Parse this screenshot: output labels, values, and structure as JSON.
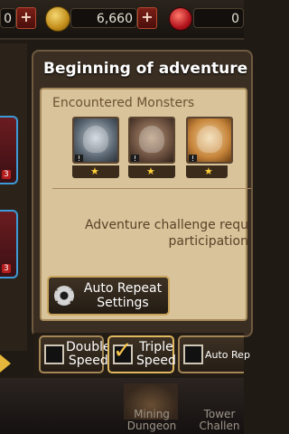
{
  "topbar": {
    "left_value": "0",
    "coins": "6,660",
    "gems": "0",
    "plus": "+"
  },
  "left_cards": [
    {
      "tag": "3"
    },
    {
      "tag": "3"
    }
  ],
  "dialog": {
    "title": "Beginning of adventure",
    "encountered_label": "Encountered Monsters",
    "monsters": [
      {
        "icon": "werewolf-icon",
        "badge": "!",
        "star": "★"
      },
      {
        "icon": "wolf-beast-icon",
        "badge": "!",
        "star": "★"
      },
      {
        "icon": "pirate-cat-icon",
        "badge": "!",
        "star": "★"
      }
    ],
    "challenge_line1": "Adventure challenge requ",
    "challenge_line2": "participation",
    "auto_repeat_line1": "Auto Repeat",
    "auto_repeat_line2": "Settings"
  },
  "speed": {
    "double_line1": "Double",
    "double_line2": "Speed",
    "double_checked": false,
    "triple_line1": "Triple",
    "triple_line2": "Speed",
    "triple_checked": true,
    "auto_rep": "Auto Rep",
    "checkmark": "✓"
  },
  "bottom": {
    "mining_line1": "Mining",
    "mining_line2": "Dungeon",
    "tower_line1": "Tower",
    "tower_line2": "Challen"
  },
  "colors": {
    "accent_gold": "#c9a45c",
    "parchment": "#d8c39a",
    "star": "#ffd23a"
  }
}
